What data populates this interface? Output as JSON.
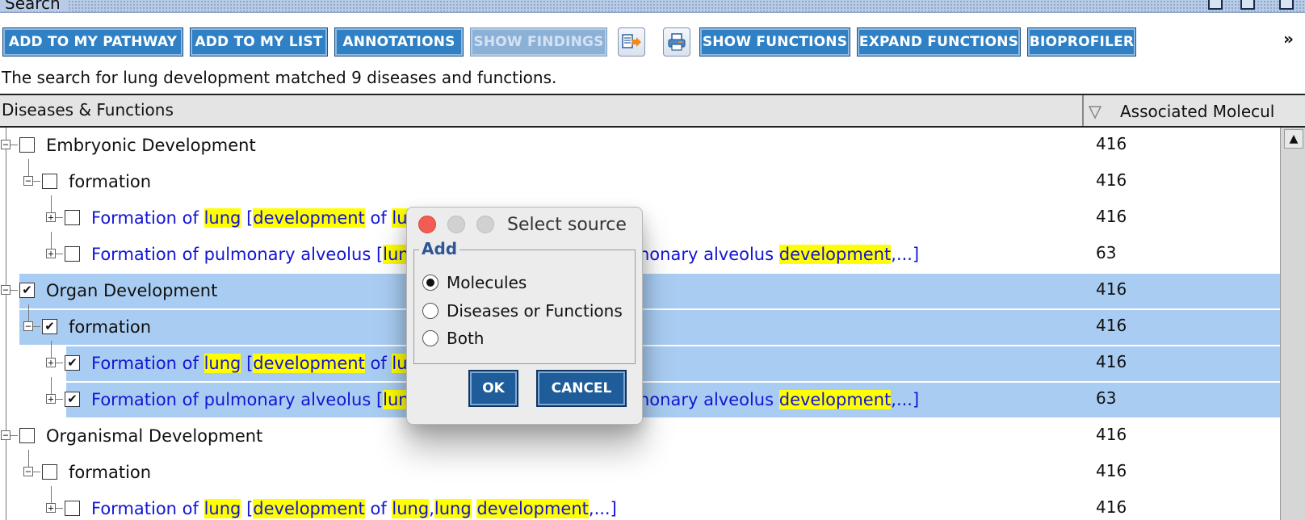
{
  "window": {
    "title": "Search"
  },
  "toolbar": {
    "buttons": [
      {
        "label": "ADD TO MY PATHWAY",
        "enabled": true
      },
      {
        "label": "ADD TO MY LIST",
        "enabled": true
      },
      {
        "label": "ANNOTATIONS",
        "enabled": true
      },
      {
        "label": "SHOW FINDINGS",
        "enabled": false
      },
      {
        "label": "SHOW FUNCTIONS",
        "enabled": true
      },
      {
        "label": "EXPAND FUNCTIONS",
        "enabled": true
      },
      {
        "label": "BIOPROFILER",
        "enabled": true
      }
    ],
    "icons": [
      "export-icon",
      "print-icon"
    ],
    "overflow": "»"
  },
  "summary": "The search for lung development matched 9 diseases and functions.",
  "table": {
    "columns": [
      "Diseases & Functions",
      "Associated Molecul"
    ],
    "rows": [
      {
        "label": "Embryonic Development",
        "count": "416",
        "checked": false,
        "selected": false,
        "link": false
      },
      {
        "label": "formation",
        "count": "416",
        "checked": false,
        "selected": false,
        "link": false
      },
      {
        "label_parts": [
          "Formation of ",
          "lung",
          " [",
          "development",
          " of ",
          "lu"
        ],
        "count": "416",
        "checked": false,
        "selected": false,
        "link": true
      },
      {
        "label_parts": [
          "Formation of pulmonary alveolus [",
          "lun"
        ],
        "label_tail": [
          "nonary alveolus ",
          "development",
          ",...]"
        ],
        "count": "63",
        "checked": false,
        "selected": false,
        "link": true
      },
      {
        "label": "Organ Development",
        "count": "416",
        "checked": true,
        "selected": true,
        "link": false
      },
      {
        "label": "formation",
        "count": "416",
        "checked": true,
        "selected": true,
        "link": false
      },
      {
        "label_parts": [
          "Formation of ",
          "lung",
          " [",
          "development",
          " of ",
          "lu"
        ],
        "count": "416",
        "checked": true,
        "selected": true,
        "link": true
      },
      {
        "label_parts": [
          "Formation of pulmonary alveolus [",
          "lun"
        ],
        "label_tail": [
          "nonary alveolus ",
          "development",
          ",...]"
        ],
        "count": "63",
        "checked": true,
        "selected": true,
        "link": true
      },
      {
        "label": "Organismal Development",
        "count": "416",
        "checked": false,
        "selected": false,
        "link": false
      },
      {
        "label": "formation",
        "count": "416",
        "checked": false,
        "selected": false,
        "link": false
      },
      {
        "label_parts": [
          "Formation of ",
          "lung",
          " [",
          "development",
          " of ",
          "lung",
          ",",
          "lung",
          " ",
          "development",
          ",...]"
        ],
        "count": "416",
        "checked": false,
        "selected": false,
        "link": true
      }
    ]
  },
  "dialog": {
    "title": "Select source",
    "group_label": "Add",
    "options": [
      {
        "label": "Molecules",
        "selected": true
      },
      {
        "label": "Diseases or Functions",
        "selected": false
      },
      {
        "label": "Both",
        "selected": false
      }
    ],
    "ok_label": "OK",
    "cancel_label": "CANCEL"
  },
  "colors": {
    "button_blue": "#2f80c4",
    "selection": "#a9cdf2",
    "highlight": "#ffff00",
    "link": "#1414d4"
  }
}
